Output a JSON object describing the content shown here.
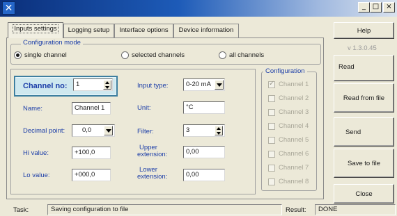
{
  "window": {
    "icon": "app-cross-icon",
    "controls": [
      "minimize-icon",
      "maximize-icon",
      "close-icon"
    ],
    "minimize": "_",
    "maximize": "□",
    "close": "×"
  },
  "tabs": [
    "Inputs settings",
    "Logging setup",
    "Interface options",
    "Device information"
  ],
  "config_mode": {
    "legend": "Configuration mode",
    "options": [
      "single channel",
      "selected channels",
      "all channels"
    ],
    "selected": "single channel"
  },
  "channel": {
    "label": "Channel no:",
    "value": "1",
    "name_label": "Name:",
    "name_value": "Channel 1",
    "decimal_label": "Decimal point:",
    "decimal_value": "0,0",
    "hi_label": "Hi value:",
    "hi_value": "+100,0",
    "lo_label": "Lo value:",
    "lo_value": "+000,0",
    "input_type_label": "Input type:",
    "input_type_value": "0-20 mA",
    "unit_label": "Unit:",
    "unit_value": "°C",
    "filter_label": "Filter:",
    "filter_value": "3",
    "upper_label_1": "Upper",
    "upper_label_2": "extension:",
    "upper_value": "0,00",
    "lower_label_1": "Lower",
    "lower_label_2": "extension:",
    "lower_value": "0,00"
  },
  "configuration": {
    "legend": "Configuration",
    "channels": [
      "Channel 1",
      "Channel 2",
      "Channel 3",
      "Channel 4",
      "Channel 5",
      "Channel 6",
      "Channel 7",
      "Channel 8"
    ],
    "checked": [
      "Channel 1"
    ]
  },
  "right_panel": {
    "help": "Help",
    "version": "v 1.3.0.45",
    "read": "Read",
    "read_from_file": "Read from file",
    "send": "Send",
    "save_to_file": "Save to file",
    "close": "Close"
  },
  "status": {
    "task_label": "Task:",
    "task_value": "Saving configuration to file",
    "result_label": "Result:",
    "result_value": "DONE"
  },
  "colors": {
    "title_bar_start": "#0b2f7a",
    "legend_text": "#1c3ea8",
    "channel_highlight": "#cfe8ef"
  }
}
